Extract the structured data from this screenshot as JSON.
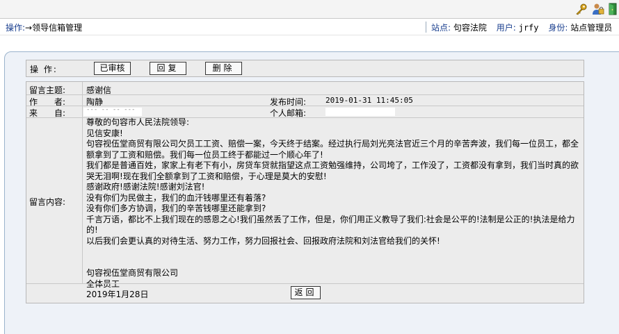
{
  "toolbar": {
    "icons": [
      "key-icon",
      "user-lock-icon",
      "exit-icon"
    ]
  },
  "statusbar": {
    "operation_label": "操作:",
    "operation_path": "→领导信箱管理",
    "site_label": "站点:",
    "site_value": "句容法院",
    "user_label": "用户:",
    "user_value": "jrfy",
    "role_label": "身份:",
    "role_value": "站点管理员"
  },
  "ops": {
    "label": "操 作:",
    "buttons": [
      "已审核",
      "回复",
      "删除"
    ]
  },
  "message": {
    "subject_label": "留言主题:",
    "subject": "感谢信",
    "author_label": "作　　者:",
    "author": "陶静",
    "time_label": "发布时间:",
    "time": "2019-01-31 11:45:05",
    "from_label": "来　　自:",
    "from": "--- -- -- ---",
    "email_label": "个人邮箱:",
    "email": "",
    "content_label": "留言内容:",
    "content": [
      "尊敬的句容市人民法院领导:",
      "见信安康!",
      "句容视伍堂商贸有限公司欠员工工资、赔偿一案，今天终于结案。经过执行局刘光亮法官近三个月的辛苦奔波，我们每一位员工，都全额拿到了工资和赔偿。我们每一位员工终于都能过一个顺心年了!",
      "我们都是普通百姓，家家上有老下有小，房贷车贷就指望这点工资勉强维持，公司垮了，工作没了，工资都没有拿到，我们当时真的欲哭无泪啊!现在我们全额拿到了工资和赔偿，于心理是莫大的安慰!",
      "感谢政府!感谢法院!感谢刘法官!",
      "没有你们为民做主，我们的血汗钱哪里还有着落?",
      "没有你们多方协调，我们的辛苦钱哪里还能拿到?",
      "千言万语，都比不上我们现在的感恩之心!我们虽然丢了工作，但是，你们用正义教导了我们:社会是公平的!法制是公正的!执法是给力的!",
      "以后我们会更认真的对待生活、努力工作，努力回报社会、回报政府法院和刘法官给我们的关怀!"
    ],
    "signature": [
      "句容视伍堂商贸有限公司",
      "全体员工",
      "2019年1月28日"
    ],
    "back_button": "返回"
  },
  "colors": {
    "link_blue": "#1a3f8f",
    "panel_border": "#9ab3cc",
    "table_bg": "#ececec"
  }
}
